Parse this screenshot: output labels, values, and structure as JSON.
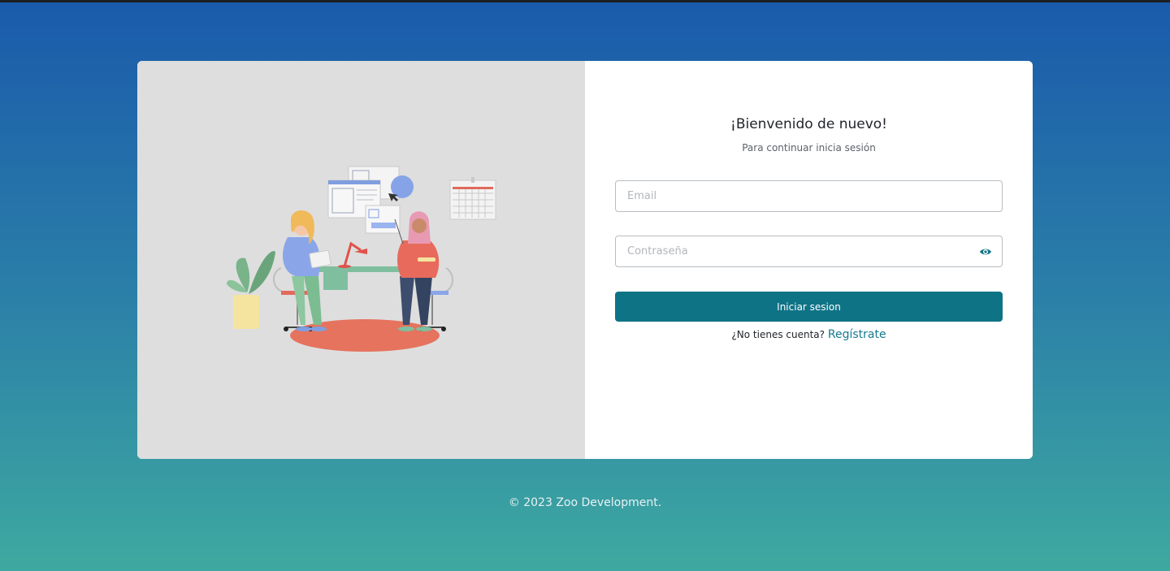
{
  "login": {
    "heading": "¡Bienvenido de nuevo!",
    "subheading": "Para continuar inicia sesión",
    "email_placeholder": "Email",
    "password_placeholder": "Contraseña",
    "submit_label": "Iniciar sesion",
    "no_account_text": "¿No tienes cuenta?",
    "register_link": "Regístrate"
  },
  "footer": {
    "copyright": "© 2023 Zoo Development."
  },
  "icons": {
    "password_toggle": "eye-icon"
  },
  "colors": {
    "primary": "#0f7386",
    "link": "#137a8f",
    "left_panel_bg": "#dedede",
    "gradient_top": "#1a5aab",
    "gradient_bottom": "#3ea9a0"
  }
}
